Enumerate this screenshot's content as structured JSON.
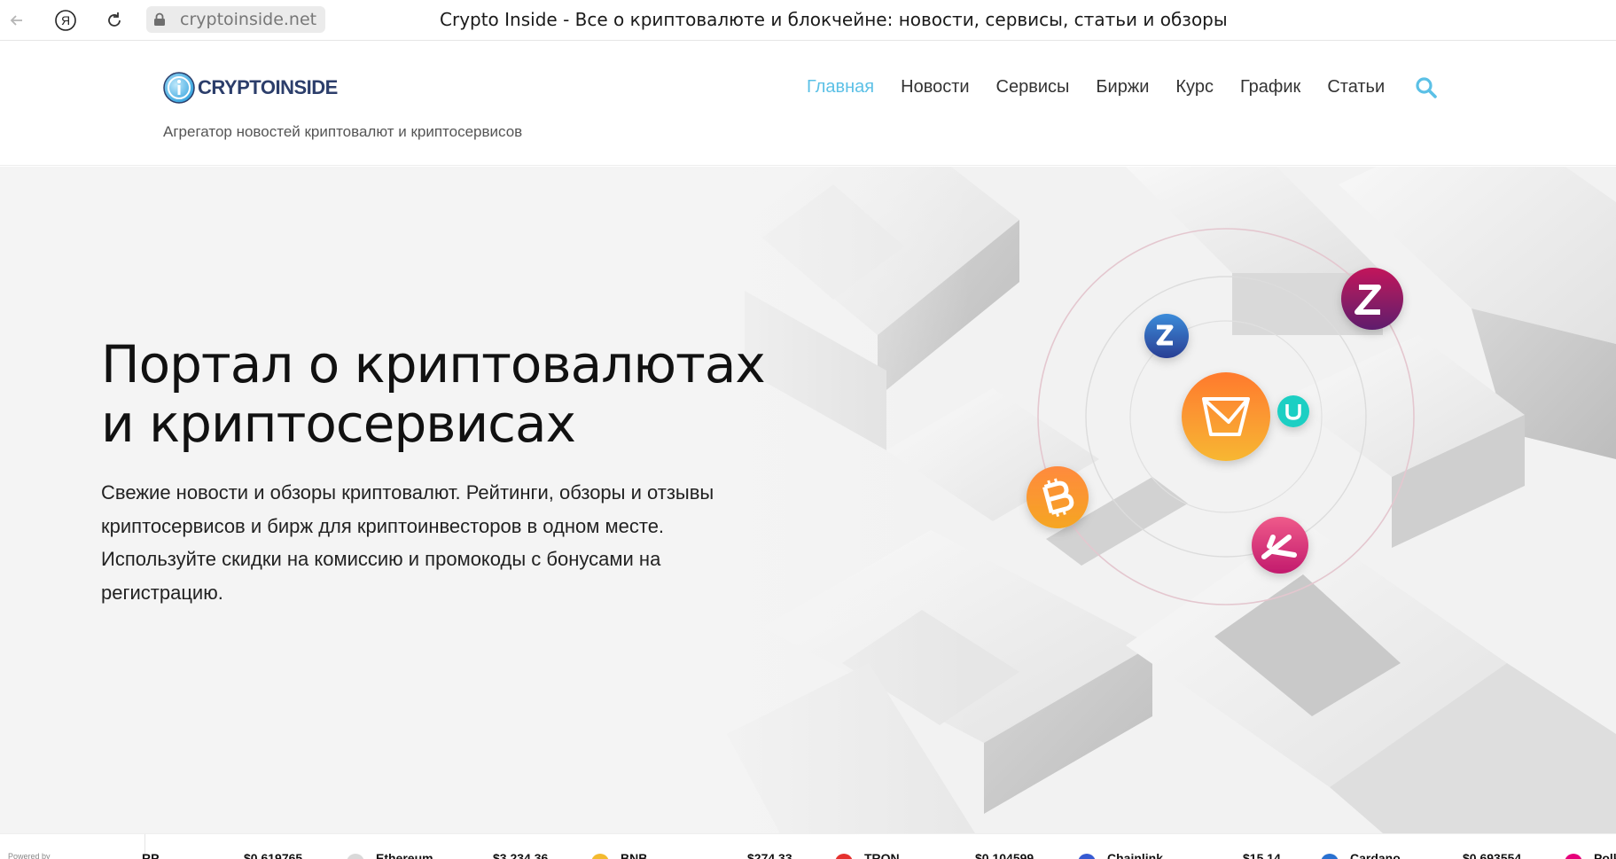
{
  "browser": {
    "url": "cryptoinside.net",
    "tab_title": "Crypto Inside - Все о криптовалюте и блокчейне: новости, сервисы, статьи и обзоры",
    "ya_label": "Я"
  },
  "site": {
    "logo_text": "CRYPTOINSIDE",
    "tagline": "Агрегатор новостей криптовалют и криптосервисов"
  },
  "nav": {
    "items": [
      {
        "label": "Главная",
        "active": true
      },
      {
        "label": "Новости"
      },
      {
        "label": "Сервисы"
      },
      {
        "label": "Биржи"
      },
      {
        "label": "Курс"
      },
      {
        "label": "График"
      },
      {
        "label": "Статьи"
      }
    ]
  },
  "hero": {
    "title": "Портал о криптовалютах и криптосервисах",
    "text_line1": "Свежие новости и обзоры криптовалют. Рейтинги, обзоры и отзывы криптосервисов и бирж для криптоинвесторов в одном месте.",
    "text_line2": "Используйте скидки на комиссию и промокоды с бонусами на регистрацию."
  },
  "ticker": {
    "powered_by": "Powered by",
    "items": [
      {
        "name": "RP",
        "price": "$0.619765",
        "color": "#23292f"
      },
      {
        "name": "Ethereum",
        "price": "$3,234.36",
        "color": "#8c8c8c"
      },
      {
        "name": "BNB",
        "price": "$274.33",
        "color": "#f3ba2f"
      },
      {
        "name": "TRON",
        "price": "$0.104599",
        "color": "#e5312e"
      },
      {
        "name": "Chainlink",
        "price": "$15.14",
        "color": "#375bd2"
      },
      {
        "name": "Cardano",
        "price": "$0.693554",
        "color": "#2a71d0"
      },
      {
        "name": "Polk",
        "price": "",
        "color": "#e6007a"
      }
    ]
  },
  "colors": {
    "accent": "#5bc0e6",
    "coin_orange": "#f7931a",
    "coin_purple": "#7a1f6b",
    "coin_blue": "#2a5fb0",
    "coin_teal": "#19c9c0",
    "coin_pink": "#e8417a"
  }
}
